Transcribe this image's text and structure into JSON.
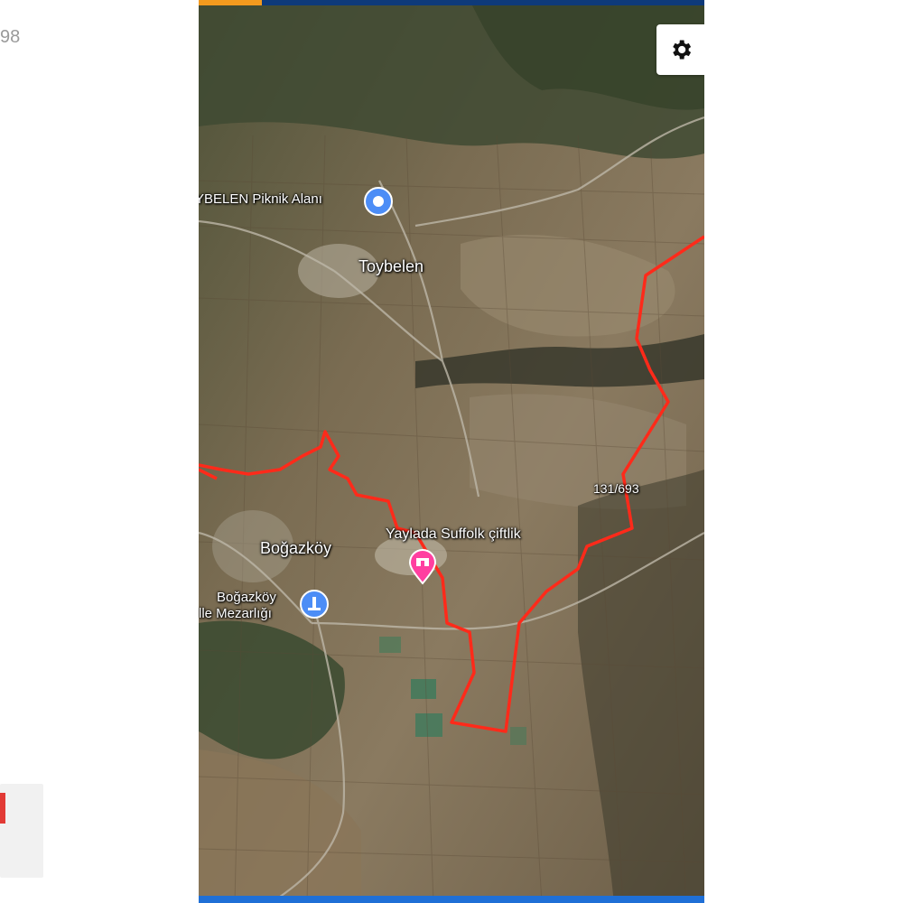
{
  "page": {
    "left_number": "98"
  },
  "map": {
    "view": "satellite",
    "settings_icon": "gear-icon",
    "boundary_color": "#ff2a1a",
    "places": [
      {
        "id": "picnic",
        "label": "YBELEN Piknik Alanı",
        "icon": "picnic-pin-icon",
        "color": "#4c8df6"
      },
      {
        "id": "village1",
        "label": "Toybelen"
      },
      {
        "id": "village2",
        "label": "Boğazköy"
      },
      {
        "id": "farm",
        "label": "Yaylada Suffolk çiftlik",
        "icon": "farm-pin-icon",
        "color": "#ff3fa0"
      },
      {
        "id": "cemetery",
        "label_line1": "Boğazköy",
        "label_line2": "lle Mezarlığı",
        "icon": "cemetery-pin-icon",
        "color": "#4c8df6"
      },
      {
        "id": "parcel",
        "label": "131/693"
      }
    ]
  }
}
